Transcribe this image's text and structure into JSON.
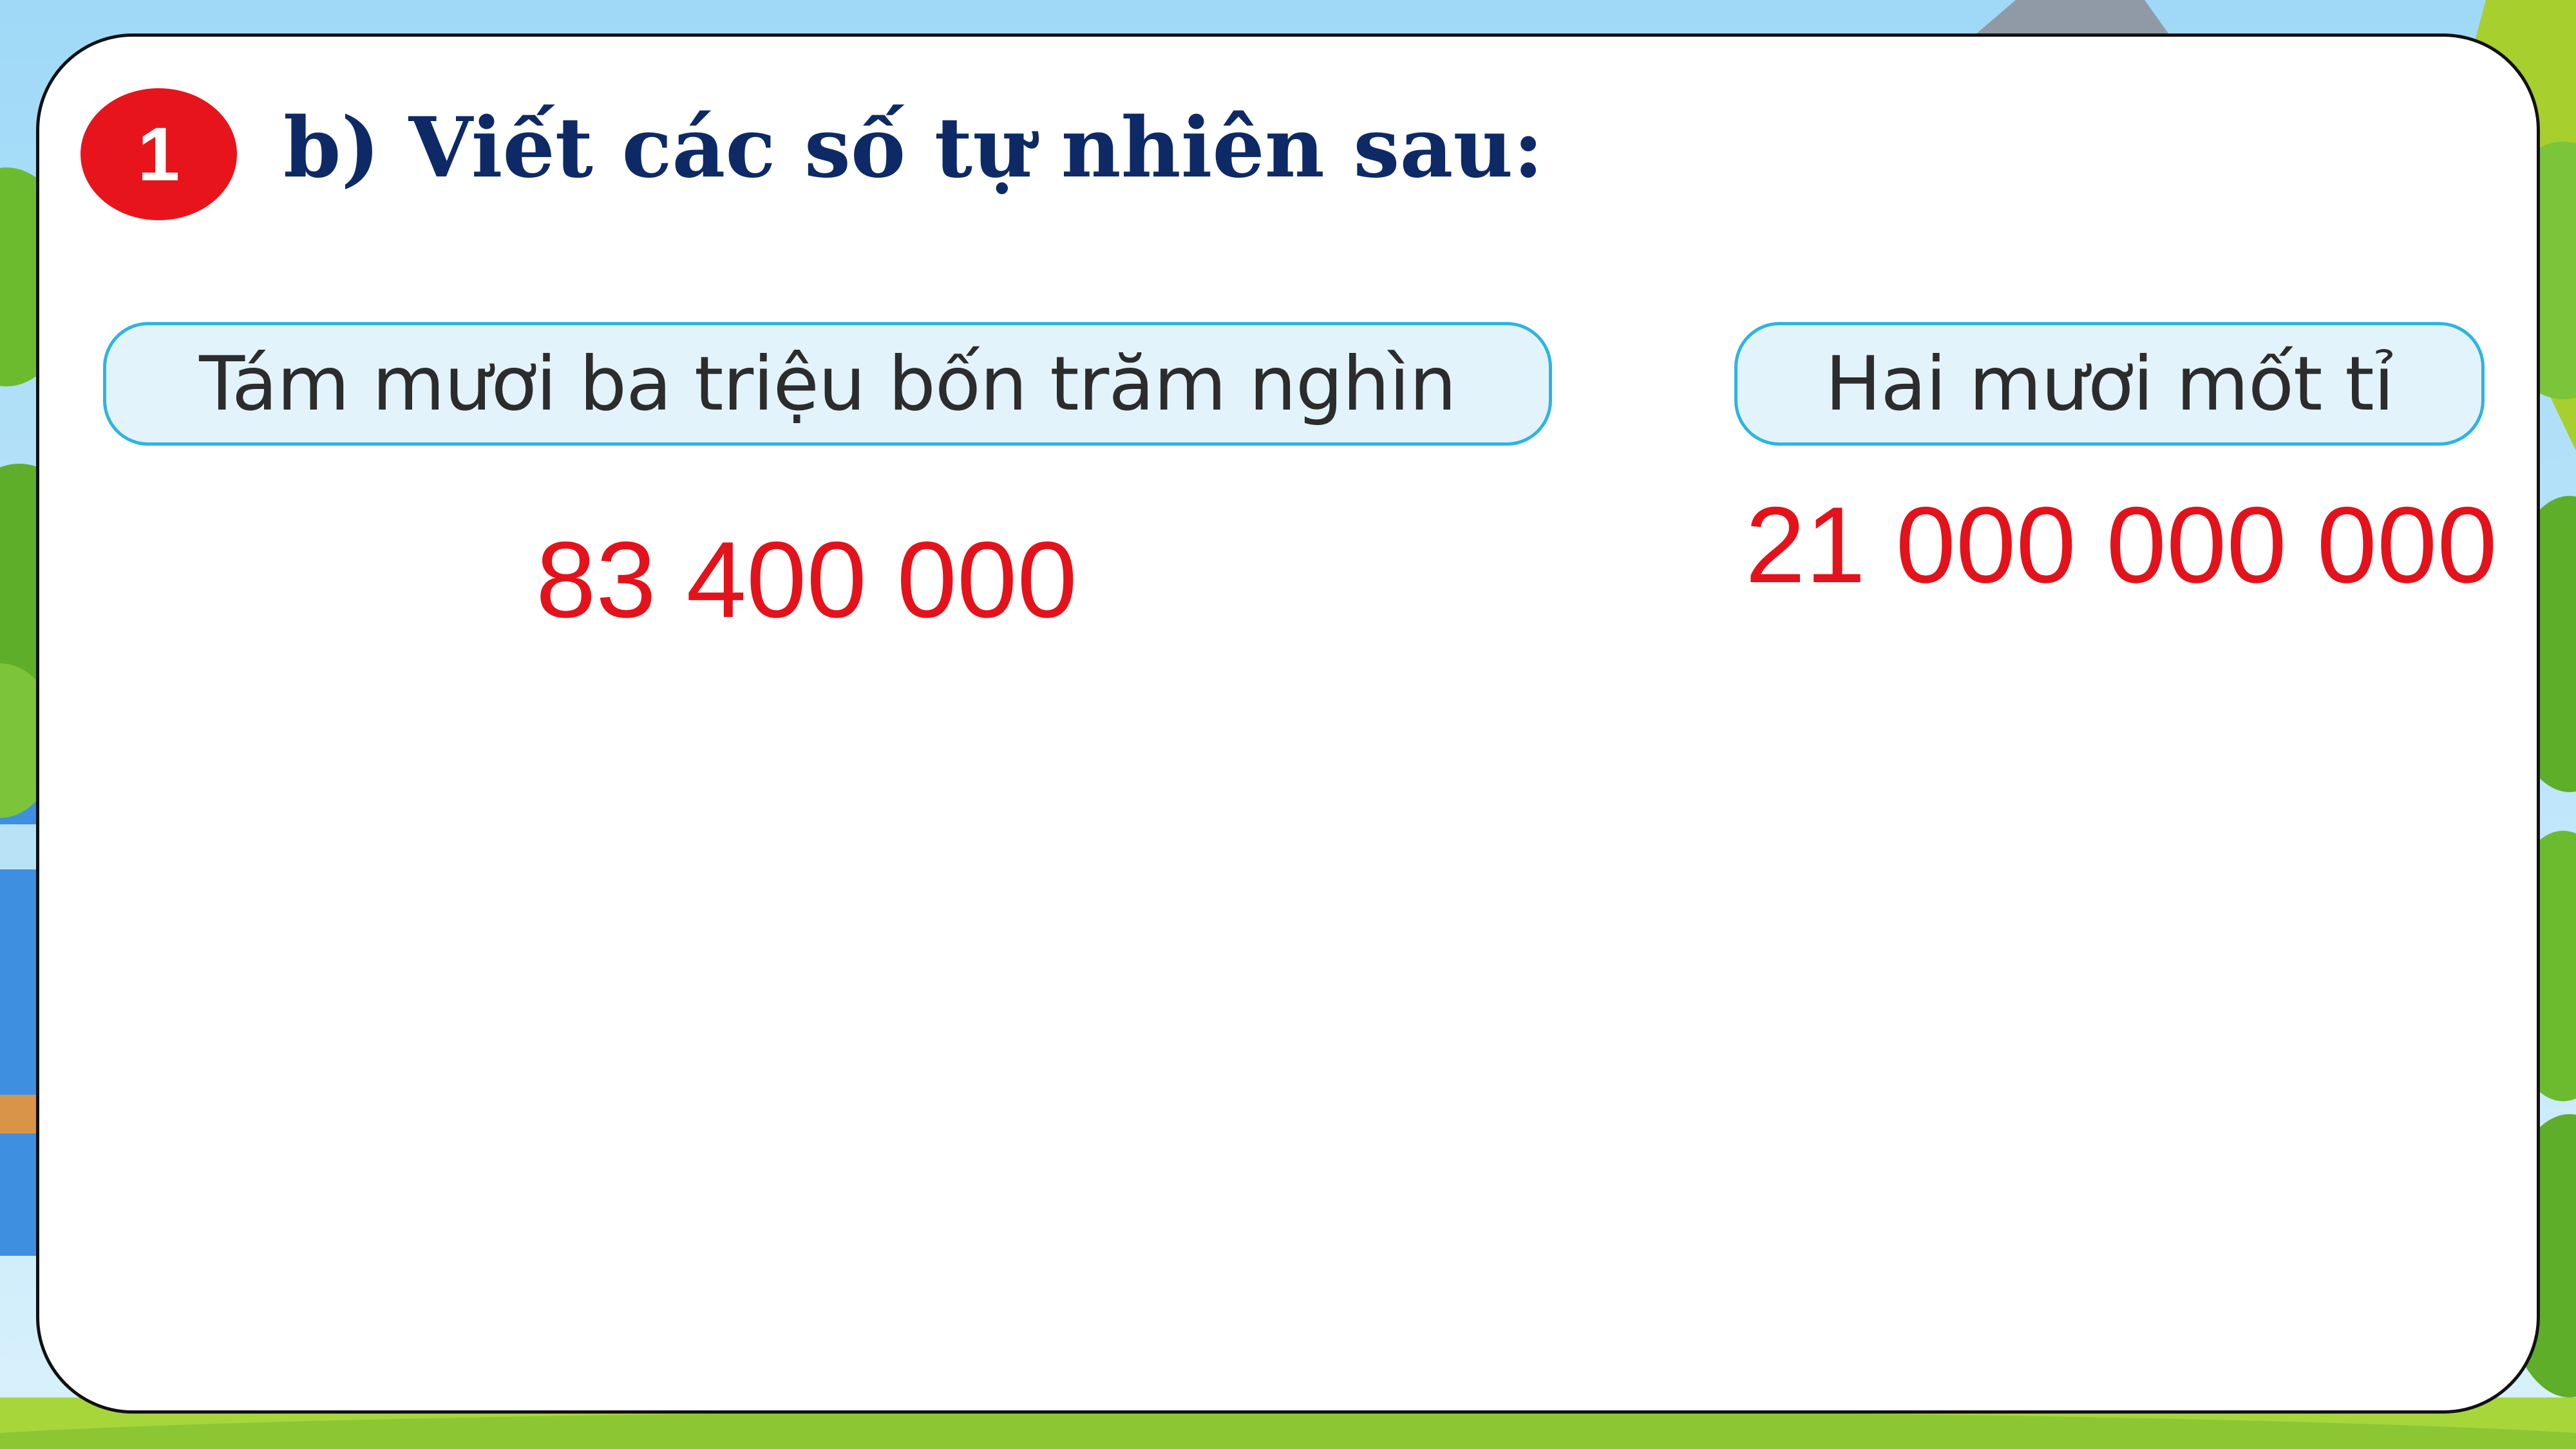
{
  "exercise": {
    "number": "1",
    "title": "b) Viết các số tự nhiên sau:"
  },
  "items": [
    {
      "prompt": "Tám mươi ba triệu bốn trăm nghìn",
      "answer": "83 400 000"
    },
    {
      "prompt": "Hai mươi mốt tỉ",
      "answer": "21 000 000 000"
    }
  ],
  "colors": {
    "badge": "#e8141c",
    "title": "#0d2a66",
    "answer": "#e3121b",
    "pill_border": "#2fb4e0",
    "pill_fill": "#e3f3fb"
  }
}
